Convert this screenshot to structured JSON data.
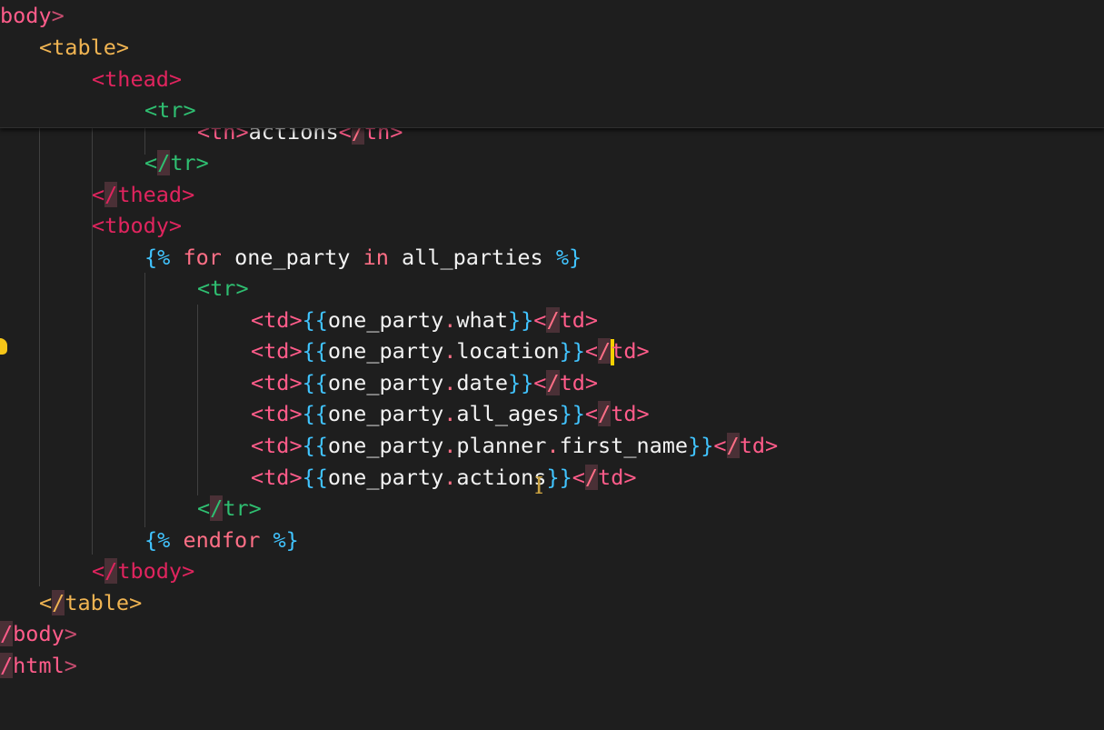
{
  "sticky": {
    "line1": {
      "open": "body",
      "close": ">"
    },
    "line2": {
      "tag": "table"
    },
    "line3": {
      "tag": "thead"
    },
    "line4": {
      "tag": "tr"
    }
  },
  "code": {
    "th_line": {
      "tag": "th",
      "text": "actions"
    },
    "tr_close": "tr",
    "thead_close": "thead",
    "tbody_open": "tbody",
    "for_tag": {
      "open": "{%",
      "kw_for": "for",
      "var": "one_party",
      "kw_in": "in",
      "iter": "all_parties",
      "close": "%}"
    },
    "tr_open": "tr",
    "td_lines": [
      {
        "obj": "one_party",
        "attr": "what",
        "attr2": ""
      },
      {
        "obj": "one_party",
        "attr": "location",
        "attr2": ""
      },
      {
        "obj": "one_party",
        "attr": "date",
        "attr2": ""
      },
      {
        "obj": "one_party",
        "attr": "all_ages",
        "attr2": ""
      },
      {
        "obj": "one_party",
        "attr": "planner",
        "attr2": "first_name"
      },
      {
        "obj": "one_party",
        "attr": "actions",
        "attr2": ""
      }
    ],
    "tr_close2": "tr",
    "endfor": {
      "open": "{%",
      "kw": "endfor",
      "close": "%}"
    },
    "tbody_close": "tbody",
    "table_close": "table",
    "body_close": "body",
    "html_close": "html"
  },
  "colors": {
    "background": "#1e1e1e",
    "tag_red": "#ff5c8a",
    "tag_maroon": "#e0245e",
    "tag_orange": "#f0b452",
    "tag_green": "#2fbf71",
    "template_blue": "#41c4ff",
    "cursor_yellow": "#f5d000"
  },
  "icons": {
    "lightbulb": "lightbulb-icon",
    "text_cursor": "text-cursor-icon"
  }
}
